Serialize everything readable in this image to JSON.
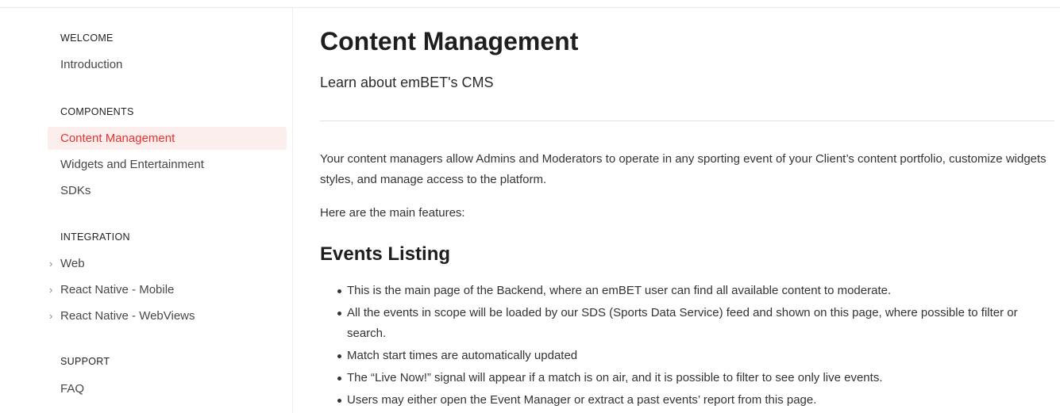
{
  "sidebar": {
    "sections": [
      {
        "title": "WELCOME",
        "items": [
          {
            "label": "Introduction"
          }
        ]
      },
      {
        "title": "COMPONENTS",
        "items": [
          {
            "label": "Content Management",
            "active": true
          },
          {
            "label": "Widgets and Entertainment"
          },
          {
            "label": "SDKs"
          }
        ]
      },
      {
        "title": "INTEGRATION",
        "items": [
          {
            "label": "Web",
            "expandable": true
          },
          {
            "label": "React Native - Mobile",
            "expandable": true
          },
          {
            "label": "React Native - WebViews",
            "expandable": true
          }
        ]
      },
      {
        "title": "SUPPORT",
        "items": [
          {
            "label": "FAQ"
          }
        ]
      }
    ]
  },
  "main": {
    "title": "Content Management",
    "subtitle": "Learn about emBET's CMS",
    "paragraphs": [
      "Your content managers allow Admins and Moderators to operate in any sporting event of your Client’s content portfolio, customize widgets styles, and manage access to the platform.",
      "Here are the main features:"
    ],
    "section_heading": "Events Listing",
    "bullets": [
      "This is the main page of the Backend, where an emBET user can find all available content to moderate.",
      "All the events in scope will be loaded by our SDS (Sports Data Service) feed and shown on this page, where possible to filter or search.",
      "Match start times are automatically updated",
      "The “Live Now!” signal will appear if a match is on air, and it is possible to filter to see only live events.",
      "Users may either open the Event Manager or extract a past events’ report from this page."
    ]
  },
  "colors": {
    "accent": "#e8322f",
    "active_bg": "#fdeeee"
  },
  "icons": {
    "expand": "chevron-right-icon"
  }
}
